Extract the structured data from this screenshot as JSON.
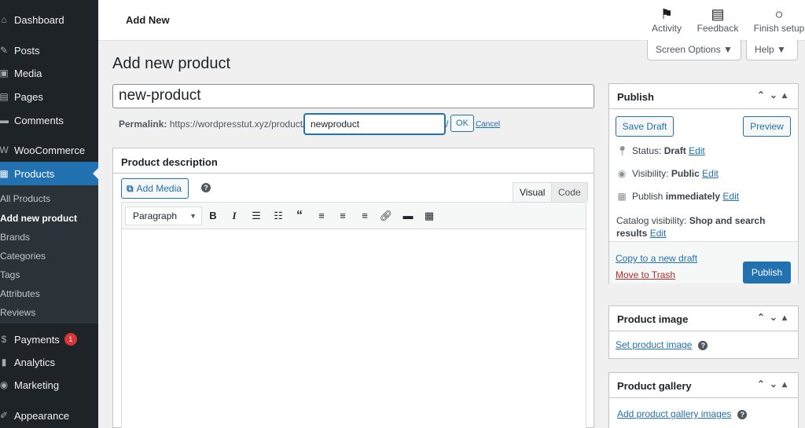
{
  "sidebar": {
    "items": [
      {
        "label": "Dashboard",
        "icon": "dashboard-icon",
        "glyph": "⌂"
      },
      {
        "label": "Posts",
        "icon": "pin-icon",
        "glyph": "✎"
      },
      {
        "label": "Media",
        "icon": "media-icon",
        "glyph": "▣"
      },
      {
        "label": "Pages",
        "icon": "pages-icon",
        "glyph": "▤"
      },
      {
        "label": "Comments",
        "icon": "comments-icon",
        "glyph": "▬"
      },
      {
        "label": "WooCommerce",
        "icon": "woocommerce-icon",
        "glyph": "W"
      },
      {
        "label": "Products",
        "icon": "products-icon",
        "glyph": "▦"
      },
      {
        "label": "Payments",
        "icon": "payments-icon",
        "glyph": "$",
        "badge": "1"
      },
      {
        "label": "Analytics",
        "icon": "analytics-icon",
        "glyph": "▮"
      },
      {
        "label": "Marketing",
        "icon": "marketing-icon",
        "glyph": "◉"
      },
      {
        "label": "Appearance",
        "icon": "appearance-icon",
        "glyph": "✐"
      }
    ],
    "submenu": [
      "All Products",
      "Add new product",
      "Brands",
      "Categories",
      "Tags",
      "Attributes",
      "Reviews"
    ]
  },
  "topbar": {
    "title": "Add New",
    "actions": [
      {
        "label": "Activity",
        "icon": "flag-icon"
      },
      {
        "label": "Feedback",
        "icon": "feedback-icon"
      },
      {
        "label": "Finish setup",
        "icon": "circle-icon"
      }
    ]
  },
  "screen_options": {
    "label": "Screen Options ▼",
    "help": "Help ▼"
  },
  "page_title": "Add new product",
  "title_input": {
    "value": "new-product"
  },
  "permalink": {
    "label": "Permalink:",
    "base": "https://wordpresstut.xyz/product/",
    "slug": "newproduct",
    "slash": "/",
    "ok": "OK",
    "cancel": "Cancel"
  },
  "editor": {
    "heading": "Product description",
    "add_media": "Add Media",
    "help": "?",
    "tab_visual": "Visual",
    "tab_code": "Code",
    "format": "Paragraph"
  },
  "publish": {
    "heading": "Publish",
    "save_draft": "Save Draft",
    "preview": "Preview",
    "status_label": "Status:",
    "status_value": "Draft",
    "visibility_label": "Visibility:",
    "visibility_value": "Public",
    "publish_label": "Publish",
    "publish_value": "immediately",
    "catalog_label": "Catalog visibility:",
    "catalog_value": "Shop and search",
    "catalog_value2": "results",
    "edit": "Edit",
    "copy_draft": "Copy to a new draft",
    "trash": "Move to Trash",
    "publish_button": "Publish"
  },
  "product_image": {
    "heading": "Product image",
    "link": "Set product image"
  },
  "product_gallery": {
    "heading": "Product gallery",
    "link": "Add product gallery images"
  },
  "colors": {
    "accent": "#2271b1",
    "sidebar": "#1d2327",
    "badge": "#d63638"
  }
}
